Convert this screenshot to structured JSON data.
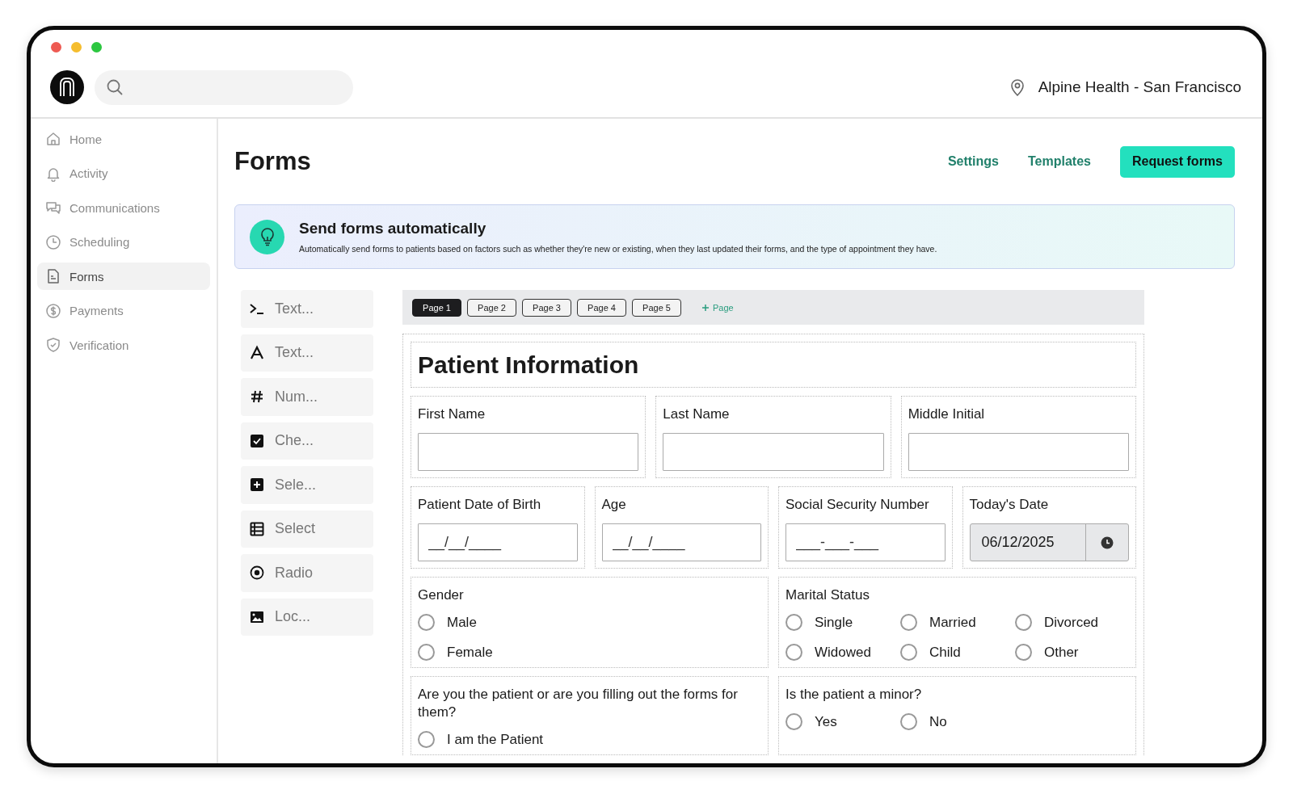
{
  "header": {
    "location": "Alpine Health - San Francisco"
  },
  "sidebar": {
    "items": [
      {
        "label": "Home",
        "selected": false
      },
      {
        "label": "Activity",
        "selected": false
      },
      {
        "label": "Communications",
        "selected": false
      },
      {
        "label": "Scheduling",
        "selected": false
      },
      {
        "label": "Forms",
        "selected": true
      },
      {
        "label": "Payments",
        "selected": false
      },
      {
        "label": "Verification",
        "selected": false
      }
    ]
  },
  "page": {
    "title": "Forms",
    "links": [
      "Settings",
      "Templates"
    ],
    "primary_button": "Request forms"
  },
  "banner": {
    "title": "Send forms automatically",
    "text": "Automatically send forms to patients based on factors such as whether they're new or existing, when they last updated their forms, and the type of appointment they have."
  },
  "palette": [
    {
      "kind": "terminal",
      "label": "Text..."
    },
    {
      "kind": "letter",
      "label": "Text..."
    },
    {
      "kind": "number",
      "label": "Num..."
    },
    {
      "kind": "checkbox",
      "label": "Che..."
    },
    {
      "kind": "plus",
      "label": "Sele..."
    },
    {
      "kind": "list",
      "label": "Select"
    },
    {
      "kind": "radio",
      "label": "Radio"
    },
    {
      "kind": "image",
      "label": "Loc..."
    }
  ],
  "page_tabs": [
    {
      "label": "Page 1",
      "selected": true
    },
    {
      "label": "Page 2",
      "selected": false
    },
    {
      "label": "Page 3",
      "selected": false
    },
    {
      "label": "Page 4",
      "selected": false
    },
    {
      "label": "Page 5",
      "selected": false
    }
  ],
  "add_page": "Page",
  "form": {
    "title": "Patient Information",
    "rows": [
      [
        {
          "kind": "text",
          "label": "First Name"
        },
        {
          "kind": "text",
          "label": "Last Name"
        },
        {
          "kind": "text",
          "label": "Middle Initial"
        }
      ],
      [
        {
          "kind": "text",
          "label": "Patient Date of Birth",
          "placeholder": "__/__/____"
        },
        {
          "kind": "text",
          "label": "Age",
          "placeholder": "__/__/____"
        },
        {
          "kind": "text",
          "label": "Social Security Number",
          "placeholder": "___-___-___"
        },
        {
          "kind": "date",
          "label": "Today's Date",
          "value": "06/12/2025",
          "disabled": true
        }
      ],
      [
        {
          "kind": "radio_list",
          "label": "Gender",
          "options": [
            {
              "label": "Male",
              "selected": false
            },
            {
              "label": "Female",
              "selected": false
            }
          ]
        },
        {
          "kind": "radio_row",
          "label": "Marital Status",
          "options": [
            {
              "label": "Single",
              "selected": false
            },
            {
              "label": "Married",
              "selected": false
            },
            {
              "label": "Divorced",
              "selected": false
            },
            {
              "label": "Widowed",
              "selected": false
            },
            {
              "label": "Child",
              "selected": false
            },
            {
              "label": "Other",
              "selected": false
            }
          ]
        }
      ],
      [
        {
          "kind": "radio_list",
          "label": "Are you the patient or are you filling out the forms for them?",
          "options": [
            {
              "label": "I am the Patient",
              "selected": false
            }
          ]
        },
        {
          "kind": "radio_row",
          "label": "Is the patient a minor?",
          "options": [
            {
              "label": "Yes",
              "selected": false
            },
            {
              "label": "No",
              "selected": false
            }
          ]
        }
      ]
    ]
  }
}
